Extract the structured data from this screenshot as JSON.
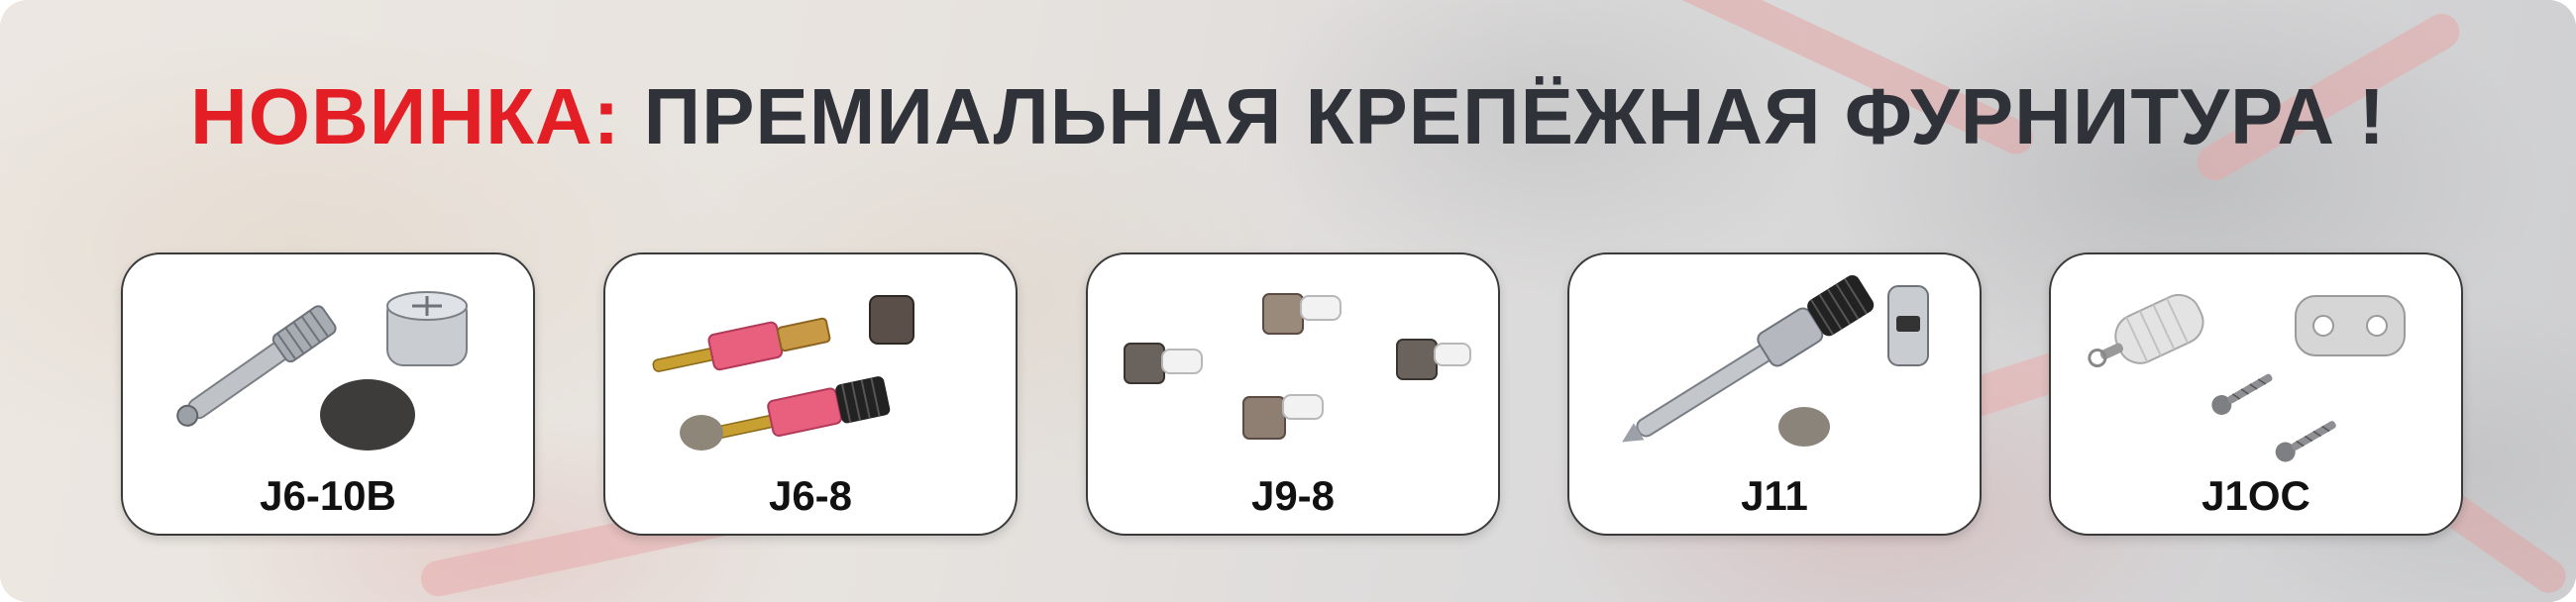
{
  "banner": {
    "title_accent": "НОВИНКА:",
    "title_main": "ПРЕМИАЛЬНАЯ КРЕПЁЖНАЯ ФУРНИТУРА !",
    "accent_color": "#e31e24",
    "text_color": "#2f3238"
  },
  "products": [
    {
      "label": "J6-10B"
    },
    {
      "label": "J6-8"
    },
    {
      "label": "J9-8"
    },
    {
      "label": "J11"
    },
    {
      "label": "J1OC"
    }
  ]
}
